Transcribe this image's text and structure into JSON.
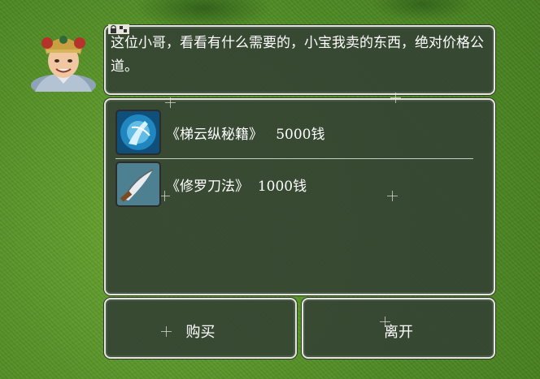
{
  "npc": {
    "portrait_icon": "npc-portrait-icon",
    "dialog_text": "这位小哥，看看有什么需要的，小宝我卖的东西，绝对价格公道。"
  },
  "shop": {
    "items": [
      {
        "name": "《梯云纵秘籍》",
        "price": "5000钱",
        "icon": "martial-art-book-icon"
      },
      {
        "name": "《修罗刀法》",
        "price": "1000钱",
        "icon": "blade-skill-icon"
      }
    ]
  },
  "buttons": {
    "buy_label": "购买",
    "leave_label": "离开"
  },
  "colors": {
    "panel_bg": "#364434",
    "panel_border": "#e6e6dc",
    "text": "#ffffff",
    "grass": "#5a9a2c"
  }
}
